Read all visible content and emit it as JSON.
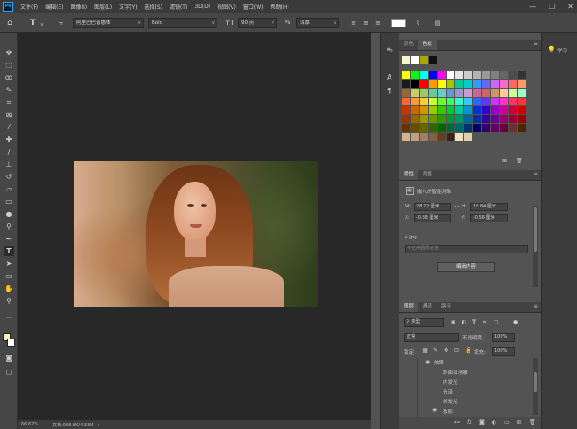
{
  "app": {
    "logo": "Ps"
  },
  "menu": [
    "文件(F)",
    "编辑(E)",
    "图像(I)",
    "图层(L)",
    "文字(Y)",
    "选择(S)",
    "滤镜(T)",
    "3D(D)",
    "视图(V)",
    "窗口(W)",
    "帮助(H)"
  ],
  "window_controls": {
    "minimize": "—",
    "maximize": "☐",
    "close": "✕"
  },
  "options": {
    "font_family": "阿里巴巴普惠体",
    "font_style": "Bold",
    "font_size": "90 点",
    "antialias": "浑厚",
    "icon_home": "home-icon",
    "icon_text_tool": "text-tool-icon"
  },
  "status": {
    "zoom": "66.67%",
    "doc": "文档:988.8K/4.33M"
  },
  "swatches": {
    "tabs": [
      "颜色",
      "色板"
    ],
    "recent": [
      "#f5f5c8",
      "#ffffff",
      "#a8a800",
      "#101010"
    ],
    "grid_rows": [
      [
        "#ffff00",
        "#00ff00",
        "#00ffff",
        "#0000ff",
        "#ff00ff",
        "#ffffff",
        "#e6e6e6",
        "#cccccc",
        "#b3b3b3",
        "#999999",
        "#808080",
        "#666666",
        "#4d4d4d",
        "#333333"
      ],
      [
        "#1a1a1a",
        "#000000",
        "#ff0000",
        "#ff9900",
        "#ffff00",
        "#99cc00",
        "#00cc99",
        "#00cccc",
        "#3399ff",
        "#6666ff",
        "#cc66ff",
        "#ff66cc",
        "#ff6666",
        "#ff9966"
      ],
      [
        "#996633",
        "#cccc66",
        "#99cc66",
        "#66cc99",
        "#66cccc",
        "#6699cc",
        "#9999cc",
        "#cc99cc",
        "#cc6699",
        "#cc6666",
        "#cc9966",
        "#ffcc99",
        "#ccff99",
        "#99ffcc"
      ],
      [
        "#ff6633",
        "#ff9933",
        "#ffcc33",
        "#ccff33",
        "#66ff33",
        "#33ff66",
        "#33ffcc",
        "#33ccff",
        "#3366ff",
        "#6633ff",
        "#cc33ff",
        "#ff33cc",
        "#ff3366",
        "#ff3333"
      ],
      [
        "#cc3300",
        "#cc6600",
        "#cc9900",
        "#99cc00",
        "#33cc00",
        "#00cc33",
        "#00cc99",
        "#0099cc",
        "#0033cc",
        "#3300cc",
        "#9900cc",
        "#cc0099",
        "#cc0033",
        "#cc0000"
      ],
      [
        "#993300",
        "#996600",
        "#999900",
        "#669900",
        "#339900",
        "#009933",
        "#009966",
        "#006699",
        "#003399",
        "#330099",
        "#660099",
        "#990066",
        "#990033",
        "#990000"
      ],
      [
        "#663300",
        "#664d00",
        "#666600",
        "#336600",
        "#006600",
        "#006633",
        "#006666",
        "#003366",
        "#000066",
        "#330066",
        "#660066",
        "#660033",
        "#663333",
        "#4d2600"
      ],
      [
        "#d2b48c",
        "#c0a080",
        "#a08060",
        "#806040",
        "#604020",
        "#402010",
        "#f0e0c0",
        "#e0d0b0"
      ]
    ]
  },
  "properties": {
    "tabs": [
      "属性",
      "调整"
    ],
    "layer_type": "嵌入的智能对象",
    "w_label": "W:",
    "w_value": "28.22 厘米",
    "h_label": "H:",
    "h_value": "18.84 厘米",
    "x_label": "X:",
    "x_value": "-0.88 厘米",
    "y_label": "Y:",
    "y_value": "-0.56 厘米",
    "filename": "4.jpg",
    "comp_placeholder": "不应用图层复合",
    "edit_button": "编辑内容"
  },
  "layers": {
    "tabs": [
      "图层",
      "通道",
      "路径"
    ],
    "filter_kind": "类型",
    "blend_mode": "正常",
    "opacity_label": "不透明度:",
    "opacity_value": "100%",
    "lock_label": "锁定:",
    "fill_label": "填充:",
    "fill_value": "100%",
    "effects_label": "效果",
    "effects": [
      "斜面和浮雕",
      "内发光",
      "光泽",
      "外发光"
    ],
    "shadow": "投影"
  },
  "learn": {
    "label": "学习"
  }
}
